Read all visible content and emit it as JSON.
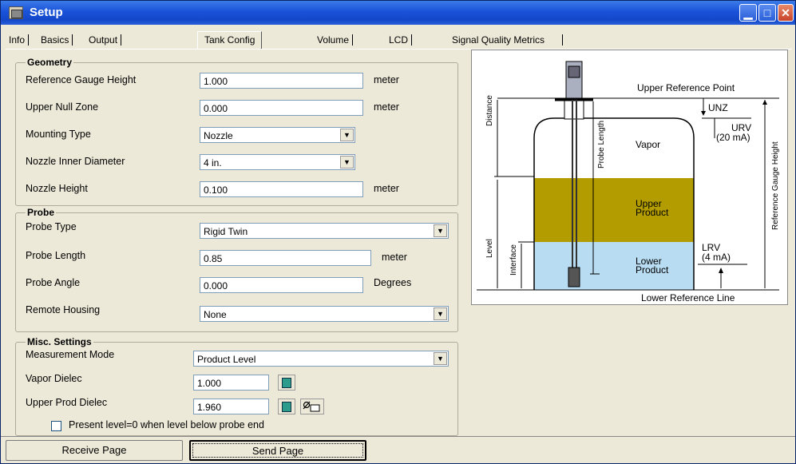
{
  "window": {
    "title": "Setup",
    "min_glyph": "▁",
    "max_glyph": "□",
    "close_glyph": "✕"
  },
  "tabs": [
    {
      "label": "Info"
    },
    {
      "label": "Basics"
    },
    {
      "label": "Output"
    },
    {
      "label": "Tank Config"
    },
    {
      "label": "Volume"
    },
    {
      "label": "LCD"
    },
    {
      "label": "Signal Quality Metrics"
    }
  ],
  "geometry": {
    "title": "Geometry",
    "reference_gauge_height": {
      "label": "Reference Gauge Height",
      "value": "1.000",
      "unit": "meter"
    },
    "upper_null_zone": {
      "label": "Upper Null Zone",
      "value": "0.000",
      "unit": "meter"
    },
    "mounting_type": {
      "label": "Mounting Type",
      "value": "Nozzle"
    },
    "nozzle_inner_diameter": {
      "label": "Nozzle Inner Diameter",
      "value": "4 in."
    },
    "nozzle_height": {
      "label": "Nozzle Height",
      "value": "0.100",
      "unit": "meter"
    }
  },
  "probe": {
    "title": "Probe",
    "probe_type": {
      "label": "Probe Type",
      "value": "Rigid Twin"
    },
    "probe_length": {
      "label": "Probe Length",
      "value": "0.85",
      "unit": "meter"
    },
    "probe_angle": {
      "label": "Probe Angle",
      "value": "0.000",
      "unit": "Degrees"
    },
    "remote_housing": {
      "label": "Remote Housing",
      "value": "None"
    }
  },
  "misc": {
    "title": "Misc. Settings",
    "measurement_mode": {
      "label": "Measurement Mode",
      "value": "Product Level"
    },
    "vapor_dielec": {
      "label": "Vapor Dielec",
      "value": "1.000"
    },
    "upper_prod_dielec": {
      "label": "Upper Prod Dielec",
      "value": "1.960"
    },
    "present_level_checkbox": {
      "label": "Present level=0 when level below probe end",
      "checked": false
    }
  },
  "diagram": {
    "upper_reference_point": "Upper Reference Point",
    "unz": "UNZ",
    "urv": "URV",
    "urv_ma": "(20 mA)",
    "vapor": "Vapor",
    "upper_product_1": "Upper",
    "upper_product_2": "Product",
    "lower_product_1": "Lower",
    "lower_product_2": "Product",
    "lrv": "LRV",
    "lrv_ma": "(4 mA)",
    "lower_reference_line": "Lower Reference Line",
    "distance": "Distance",
    "probe_length": "Probe Length",
    "level": "Level",
    "interface": "Interface",
    "reference_gauge_height": "Reference Gauge Height",
    "colors": {
      "vapor": "#ffffff",
      "upper_product": "#b29c00",
      "lower_product": "#b8dcf2"
    }
  },
  "buttons": {
    "receive_page": "Receive Page",
    "send_page": "Send Page"
  }
}
